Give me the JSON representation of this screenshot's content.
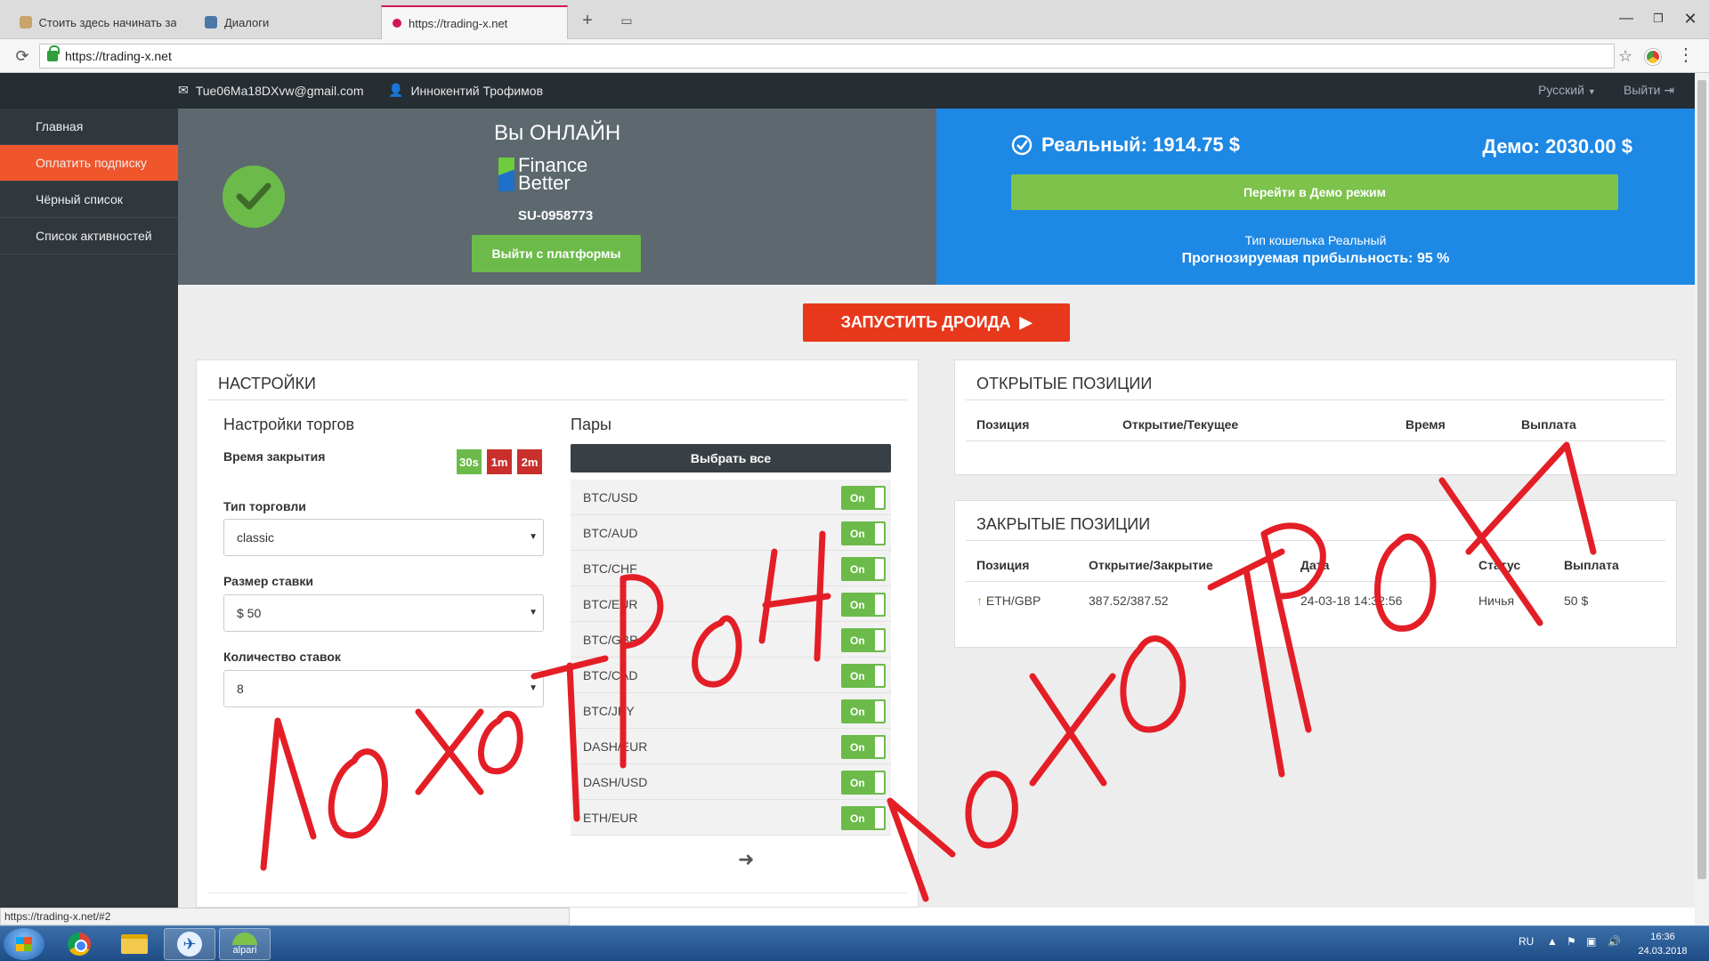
{
  "browser": {
    "tabs": [
      {
        "title": "Стоить здесь начинать зараба",
        "active": false
      },
      {
        "title": "Диалоги",
        "active": false
      },
      {
        "title": "https://trading-x.net",
        "active": true
      }
    ],
    "url": "https://trading-x.net",
    "status_url": "https://trading-x.net/#2"
  },
  "header": {
    "email": "Tue06Ma18DXvw@gmail.com",
    "user": "Иннокентий Трофимов",
    "language": "Русский",
    "exit": "Выйти"
  },
  "sidebar": {
    "items": [
      {
        "label": "Главная",
        "active": false
      },
      {
        "label": "Оплатить подписку",
        "active": true
      },
      {
        "label": "Чёрный список",
        "active": false
      },
      {
        "label": "Список активностей",
        "active": false
      }
    ]
  },
  "status_panel": {
    "title": "Вы ОНЛАЙН",
    "logo_line1": "Finance",
    "logo_line2": "Better",
    "account_id": "SU-0958773",
    "exit_button": "Выйти с платформы"
  },
  "balance": {
    "real": "Реальный: 1914.75 $",
    "demo": "Демо: 2030.00 $",
    "demo_button": "Перейти в Демо режим",
    "wallet_type": "Тип кошелька Реальный",
    "profit": "Прогнозируемая прибыльность: 95 %"
  },
  "launch_button": "ЗАПУСТИТЬ ДРОИДА",
  "settings": {
    "title": "НАСТРОЙКИ",
    "trade_settings_title": "Настройки торгов",
    "close_time_label": "Время закрытия",
    "time_options": [
      {
        "label": "30s",
        "color": "#6cbb4a"
      },
      {
        "label": "1m",
        "color": "#c9302c"
      },
      {
        "label": "2m",
        "color": "#c9302c"
      }
    ],
    "trade_type_label": "Тип торговли",
    "trade_type_value": "classic",
    "bet_size_label": "Размер ставки",
    "bet_size_value": "$ 50",
    "bet_count_label": "Количество ставок",
    "bet_count_value": "8",
    "pairs_title": "Пары",
    "select_all": "Выбрать все",
    "toggle_label": "On",
    "pairs": [
      "BTC/USD",
      "BTC/AUD",
      "BTC/CHF",
      "BTC/EUR",
      "BTC/GBP",
      "BTC/CAD",
      "BTC/JPY",
      "DASH/EUR",
      "DASH/USD",
      "ETH/EUR"
    ]
  },
  "open_positions": {
    "title": "ОТКРЫТЫЕ ПОЗИЦИИ",
    "columns": [
      "Позиция",
      "Открытие/Текущее",
      "Время",
      "Выплата"
    ]
  },
  "closed_positions": {
    "title": "ЗАКРЫТЫЕ ПОЗИЦИИ",
    "columns": [
      "Позиция",
      "Открытие/Закрытие",
      "Дата",
      "Статус",
      "Выплата"
    ],
    "rows": [
      {
        "pair": "ETH/GBP",
        "open_close": "387.52/387.52",
        "date": "24-03-18 14:32:56",
        "status": "Ничья",
        "payout": "50 $"
      }
    ]
  },
  "taskbar": {
    "alpari_label": "alpari",
    "lang": "RU",
    "time": "16:36",
    "date": "24.03.2018"
  },
  "colors": {
    "sidebar_bg": "#30373d",
    "sidebar_active": "#f0562c",
    "online_bg": "#5d686f",
    "balance_bg": "#1e88e5",
    "green": "#6cbb4a",
    "launch": "#e8381c",
    "scribble": "#e41e26"
  }
}
